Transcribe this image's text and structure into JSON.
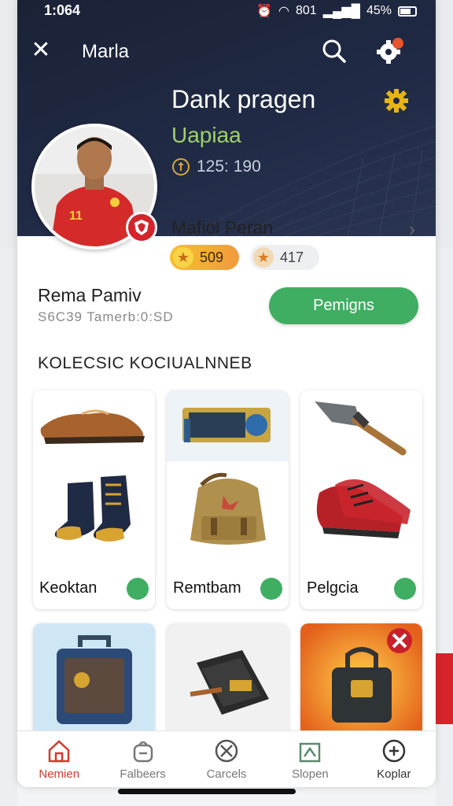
{
  "status": {
    "time": "1:064",
    "net": "801",
    "battery": "45%"
  },
  "topbar": {
    "title": "Marla"
  },
  "profile": {
    "name": "Dank pragen",
    "subtitle": "Uapiaa",
    "score": "125: 190",
    "card_name": "Mafiol Peran",
    "badges": [
      {
        "value": "509"
      },
      {
        "value": "417"
      }
    ]
  },
  "summary": {
    "title": "Rema Pamiv",
    "subtitle": "S6C39 Tamerb:0:SD",
    "button_label": "Pemigns"
  },
  "collection": {
    "title": "KOLECSIC KOCIUALNNEB",
    "items": [
      {
        "label": "Keoktan"
      },
      {
        "label": "Remtbam"
      },
      {
        "label": "Pelgcia"
      }
    ]
  },
  "nav": {
    "items": [
      {
        "label": "Nemien"
      },
      {
        "label": "Falbeers"
      },
      {
        "label": "Carcels"
      },
      {
        "label": "Slopen"
      },
      {
        "label": "Koplar"
      }
    ]
  },
  "colors": {
    "accent_green": "#3fae62",
    "header_navy": "#1e2640",
    "active_nav": "#d03a2f",
    "sub_green": "#9fd16a"
  }
}
